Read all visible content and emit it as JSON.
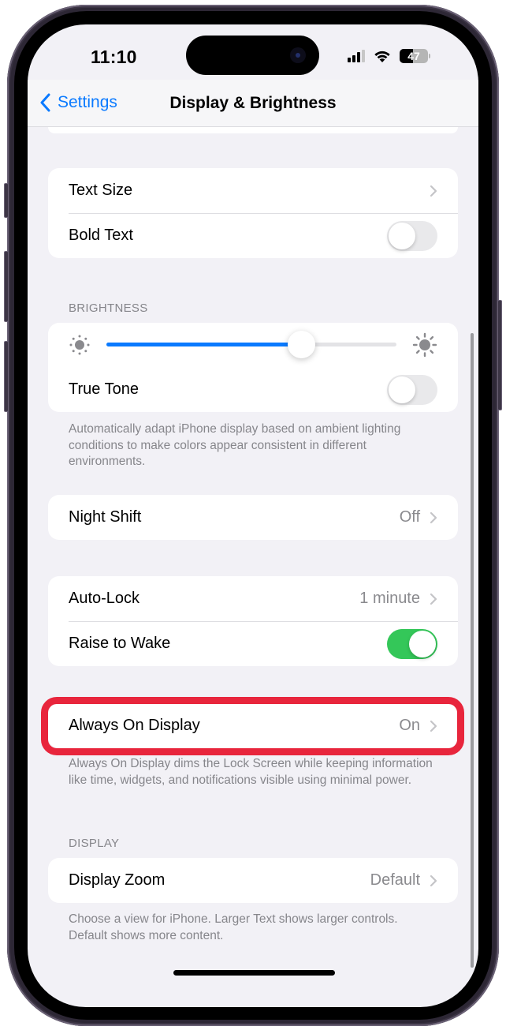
{
  "status_bar": {
    "time": "11:10",
    "signal_bars": 3,
    "signal_max": 4,
    "wifi_icon": "wifi-icon",
    "battery_percent": 47
  },
  "navbar": {
    "back_label": "Settings",
    "back_icon": "chevron-left-icon",
    "title": "Display & Brightness"
  },
  "groups": {
    "text": {
      "text_size_label": "Text Size",
      "bold_text_label": "Bold Text",
      "bold_text_on": false
    },
    "brightness": {
      "header": "BRIGHTNESS",
      "level": 0.67,
      "low_icon": "sun-min-icon",
      "high_icon": "sun-max-icon",
      "true_tone_label": "True Tone",
      "true_tone_on": false,
      "footer": "Automatically adapt iPhone display based on ambient lighting conditions to make colors appear consistent in different environments."
    },
    "night_shift": {
      "label": "Night Shift",
      "value": "Off"
    },
    "lock": {
      "auto_lock_label": "Auto-Lock",
      "auto_lock_value": "1 minute",
      "raise_to_wake_label": "Raise to Wake",
      "raise_to_wake_on": true
    },
    "always_on": {
      "label": "Always On Display",
      "value": "On",
      "footer": "Always On Display dims the Lock Screen while keeping information like time, widgets, and notifications visible using minimal power.",
      "highlight_color": "#e8253c"
    },
    "display": {
      "header": "DISPLAY",
      "zoom_label": "Display Zoom",
      "zoom_value": "Default",
      "footer": "Choose a view for iPhone. Larger Text shows larger controls. Default shows more content."
    }
  },
  "colors": {
    "accent": "#0a7aff",
    "toggle_on": "#34c759",
    "toggle_off": "#e9e9eb",
    "background": "#f2f1f6"
  }
}
